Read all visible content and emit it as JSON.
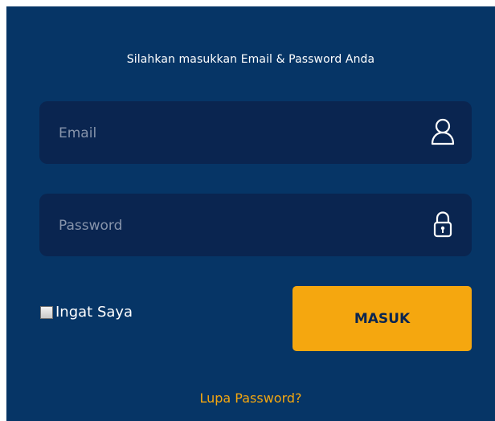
{
  "login": {
    "prompt": "Silahkan masukkan Email & Password Anda",
    "email": {
      "placeholder": "Email",
      "value": "",
      "icon": "user-icon"
    },
    "password": {
      "placeholder": "Password",
      "value": "",
      "icon": "lock-icon"
    },
    "remember_label": "Ingat Saya",
    "remember_checked": false,
    "submit_label": "MASUK",
    "forgot_label": "Lupa Password?"
  },
  "colors": {
    "panel_background": "#063566",
    "field_background": "#0a2550",
    "accent": "#f5a70f",
    "text": "#ffffff",
    "placeholder": "#8794ab"
  }
}
